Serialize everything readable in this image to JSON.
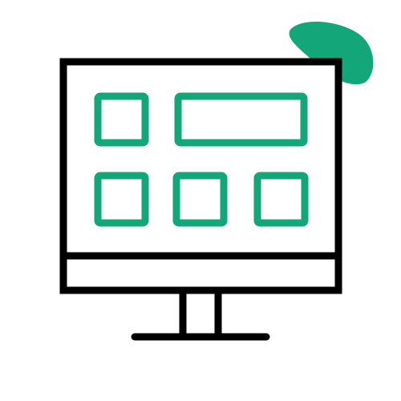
{
  "illustration": {
    "icon": "desktop-monitor-dashboard-icon",
    "colors": {
      "outline": "#000000",
      "accent": "#13a678",
      "background": "#ffffff"
    },
    "screen_tiles": {
      "top_row": [
        "square-tile",
        "wide-tile"
      ],
      "bottom_row": [
        "square-tile",
        "square-tile",
        "square-tile"
      ]
    }
  }
}
